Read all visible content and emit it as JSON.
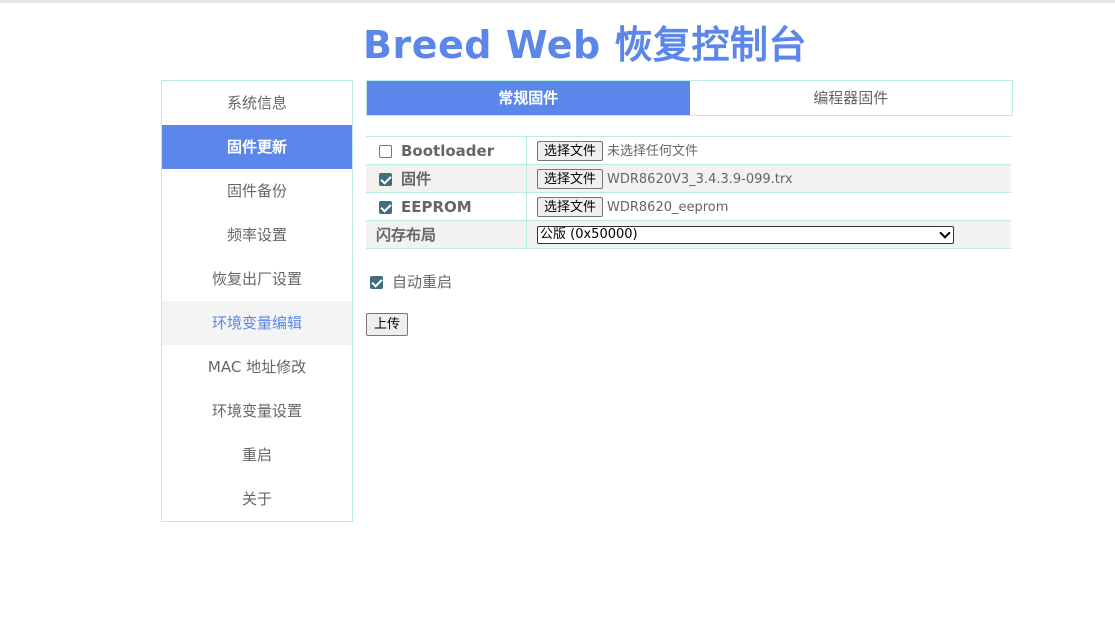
{
  "page": {
    "title": "Breed Web 恢复控制台"
  },
  "sidebar": {
    "items": [
      {
        "label": "系统信息"
      },
      {
        "label": "固件更新",
        "state": "active"
      },
      {
        "label": "固件备份"
      },
      {
        "label": "频率设置"
      },
      {
        "label": "恢复出厂设置"
      },
      {
        "label": "环境变量编辑",
        "state": "hover"
      },
      {
        "label": "MAC 地址修改"
      },
      {
        "label": "环境变量设置"
      },
      {
        "label": "重启"
      },
      {
        "label": "关于"
      }
    ]
  },
  "tabs": [
    {
      "label": "常规固件",
      "active": true
    },
    {
      "label": "编程器固件",
      "active": false
    }
  ],
  "form": {
    "rows": [
      {
        "label": "Bootloader",
        "checked": false,
        "button": "选择文件",
        "file": "未选择任何文件"
      },
      {
        "label": "固件",
        "checked": true,
        "button": "选择文件",
        "file": "WDR8620V3_3.4.3.9-099.trx"
      },
      {
        "label": "EEPROM",
        "checked": true,
        "button": "选择文件",
        "file": "WDR8620_eeprom"
      }
    ],
    "flash_layout": {
      "label": "闪存布局",
      "selected": "公版 (0x50000)"
    },
    "auto_reboot": {
      "label": "自动重启",
      "checked": true
    },
    "upload_label": "上传"
  },
  "colors": {
    "accent": "#5b87ea",
    "border": "#b7ece0",
    "checkbox": "#3f6e7e"
  }
}
